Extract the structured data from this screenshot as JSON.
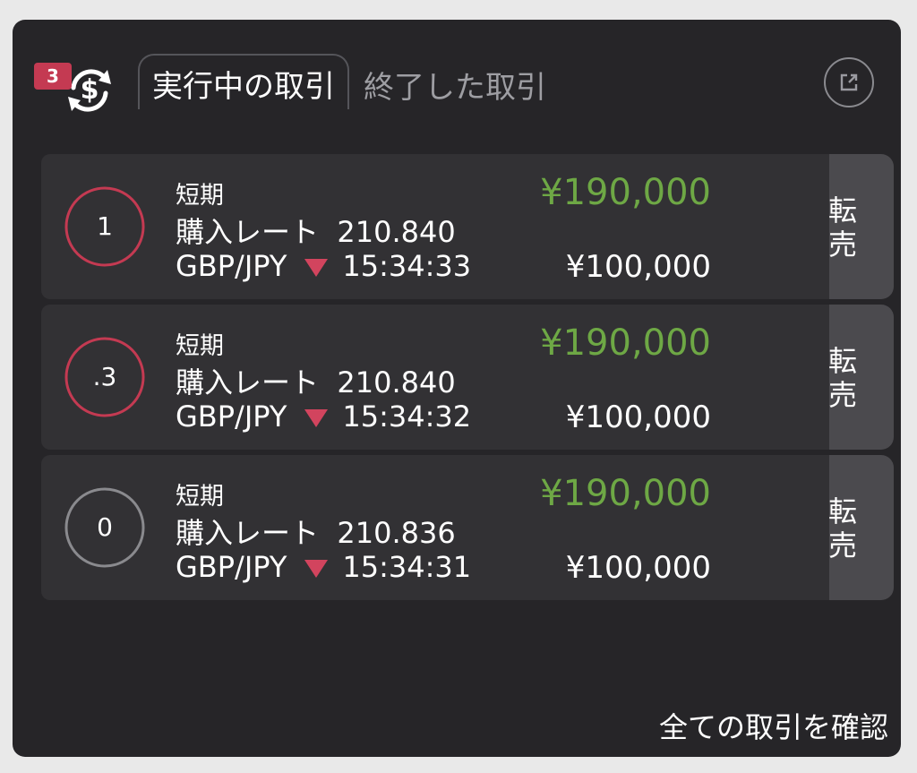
{
  "header": {
    "badge_count": "3",
    "tab_active": "実行中の取引",
    "tab_inactive": "終了した取引",
    "logo_icon": "dollar-cycle-icon",
    "external_icon": "external-link-icon"
  },
  "trades": [
    {
      "timer": "1",
      "timer_color": "#c43a52",
      "term": "短期",
      "rate_label": "購入レート",
      "rate": "210.840",
      "pair": "GBP/JPY",
      "direction": "down",
      "time": "15:34:33",
      "payout": "¥190,000",
      "amount": "¥100,000",
      "sell_label": "転売"
    },
    {
      "timer": ".3",
      "timer_color": "#c43a52",
      "term": "短期",
      "rate_label": "購入レート",
      "rate": "210.840",
      "pair": "GBP/JPY",
      "direction": "down",
      "time": "15:34:32",
      "payout": "¥190,000",
      "amount": "¥100,000",
      "sell_label": "転売"
    },
    {
      "timer": "0",
      "timer_color": "#8a8a8e",
      "term": "短期",
      "rate_label": "購入レート",
      "rate": "210.836",
      "pair": "GBP/JPY",
      "direction": "down",
      "time": "15:34:31",
      "payout": "¥190,000",
      "amount": "¥100,000",
      "sell_label": "転売"
    }
  ],
  "footer": {
    "view_all": "全ての取引を確認"
  },
  "colors": {
    "panel_bg": "#262528",
    "row_bg": "#323134",
    "sell_bg": "#4b4a4e",
    "payout_green": "#6ea845",
    "down_red": "#d2445e",
    "badge_red": "#c43a52"
  }
}
